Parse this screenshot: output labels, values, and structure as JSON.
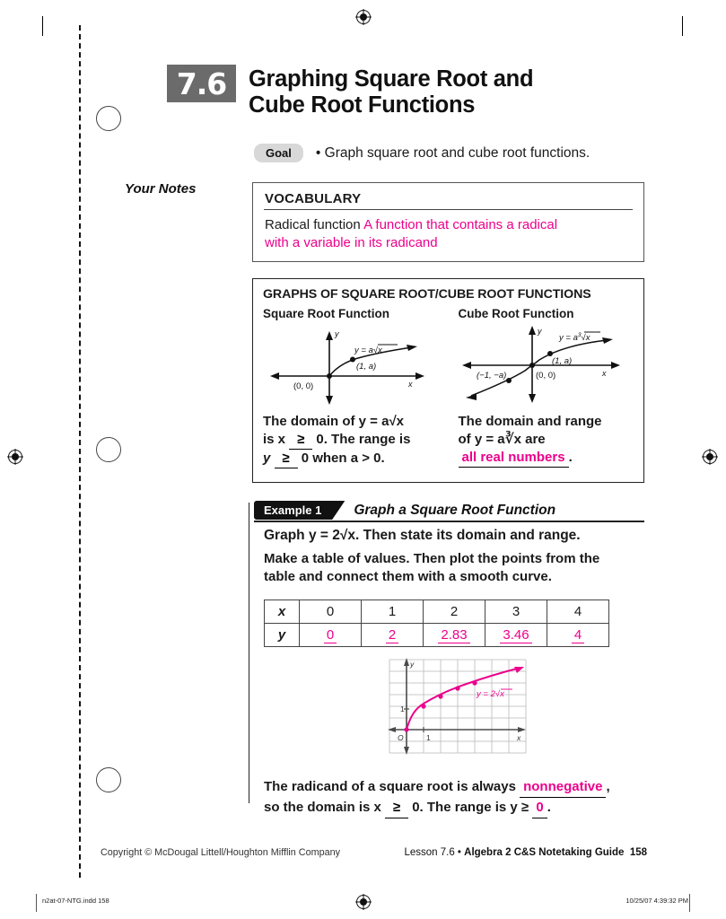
{
  "header": {
    "chapter_number": "7.6",
    "title_line1": "Graphing Square Root and",
    "title_line2": "Cube Root Functions",
    "goal_label": "Goal",
    "goal_text": "• Graph square root and cube root functions.",
    "your_notes": "Your Notes"
  },
  "vocabulary": {
    "heading": "VOCABULARY",
    "term": "Radical function",
    "answer_line1": "A function that contains a radical",
    "answer_line2": "with a variable in its radicand"
  },
  "graphs_box": {
    "heading": "GRAPHS OF SQUARE ROOT/CUBE ROOT FUNCTIONS",
    "left": {
      "subtitle": "Square Root Function",
      "curve_label": "y = a√x",
      "point_label": "(1, a)",
      "origin_label": "(0, 0)",
      "axis_x": "x",
      "axis_y": "y",
      "caption_part1": "The domain of y = a√x",
      "caption_part2": "is x",
      "blank1": "≥",
      "caption_part3": "0. The range is",
      "caption_part4": "y",
      "blank2": "≥",
      "caption_part5": "0 when a > 0."
    },
    "right": {
      "subtitle": "Cube Root Function",
      "curve_label": "y = a∛x",
      "point_label": "(1, a)",
      "origin_label": "(0, 0)",
      "neg_point_label": "(−1, −a)",
      "axis_x": "x",
      "axis_y": "y",
      "caption_part1": "The domain and range",
      "caption_part2": "of y = a∛x are",
      "answer": "all real numbers",
      "period": "."
    }
  },
  "example": {
    "tab_label": "Example 1",
    "tab_title": "Graph a Square Root Function",
    "question": "Graph y = 2√x. Then state its domain and range.",
    "instruction_line1": "Make a table of values. Then plot the points from the",
    "instruction_line2": "table and connect them with a smooth curve.",
    "table": {
      "row_x_header": "x",
      "row_y_header": "y",
      "x_values": [
        "0",
        "1",
        "2",
        "3",
        "4"
      ],
      "y_values": [
        "0",
        "2",
        "2.83",
        "3.46",
        "4"
      ]
    },
    "plot": {
      "curve_label": "y = 2√x",
      "origin_label": "O",
      "x_tick_label": "1",
      "y_tick_label": "1",
      "axis_x": "x",
      "axis_y": "y"
    },
    "conclusion_part1": "The radicand of a square root is always",
    "conclusion_answer1": "nonnegative",
    "conclusion_part2": ",",
    "conclusion_part3": "so the domain is x",
    "conclusion_blank": "≥",
    "conclusion_part4": "0. The range is y ≥",
    "conclusion_answer2": "0",
    "conclusion_part5": "."
  },
  "footer": {
    "copyright": "Copyright © McDougal Littell/Houghton Mifflin Company",
    "lesson_prefix": "Lesson 7.6 • ",
    "lesson_book": "Algebra 2 C&S Notetaking Guide",
    "page_number": "158",
    "production_file": "n2at-07-NTG.indd   158",
    "production_timestamp": "10/25/07   4:39:32 PM"
  },
  "colors": {
    "handwriting": "#ec008c",
    "chapter_badge": "#6b6b6b",
    "goal_badge": "#d8d8d8"
  },
  "chart_data": {
    "type": "line",
    "title": "y = 2√x",
    "xlabel": "x",
    "ylabel": "y",
    "x": [
      0,
      1,
      2,
      3,
      4
    ],
    "y": [
      0,
      2,
      2.83,
      3.46,
      4
    ],
    "xlim": [
      -1,
      7
    ],
    "ylim": [
      -1,
      6
    ],
    "grid": true,
    "series_color": "#ec008c",
    "markers": true
  }
}
